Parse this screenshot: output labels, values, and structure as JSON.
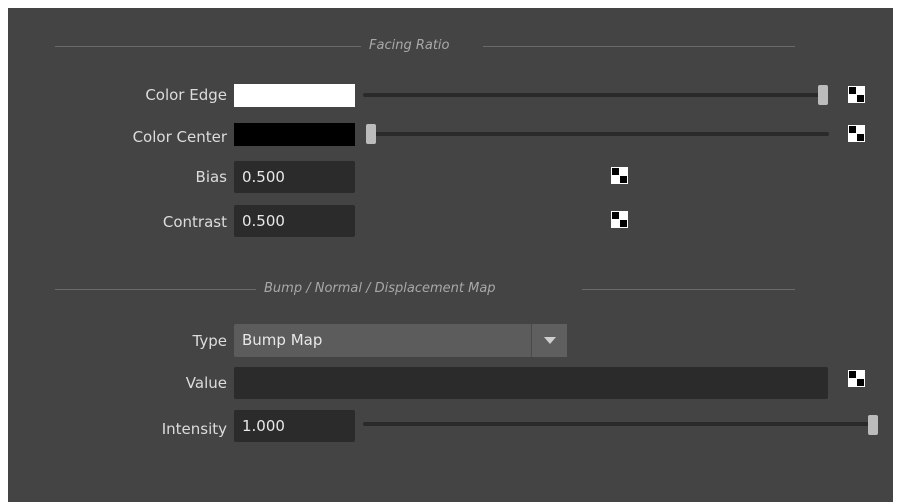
{
  "sections": {
    "facing_ratio": {
      "title": "Facing Ratio"
    },
    "bump": {
      "title": "Bump / Normal / Displacement Map"
    }
  },
  "color_edge": {
    "label": "Color Edge",
    "color": "#ffffff",
    "slider_value": 1.0
  },
  "color_center": {
    "label": "Color Center",
    "color": "#000000",
    "slider_value": 0.0
  },
  "bias": {
    "label": "Bias",
    "value": "0.500"
  },
  "contrast": {
    "label": "Contrast",
    "value": "0.500"
  },
  "type": {
    "label": "Type",
    "selected": "Bump Map"
  },
  "value_field": {
    "label": "Value",
    "value": ""
  },
  "intensity": {
    "label": "Intensity",
    "value": "1.000",
    "slider_value": 1.0
  },
  "icons": {
    "map": "checker-map-icon",
    "dropdown": "chevron-down-icon"
  }
}
